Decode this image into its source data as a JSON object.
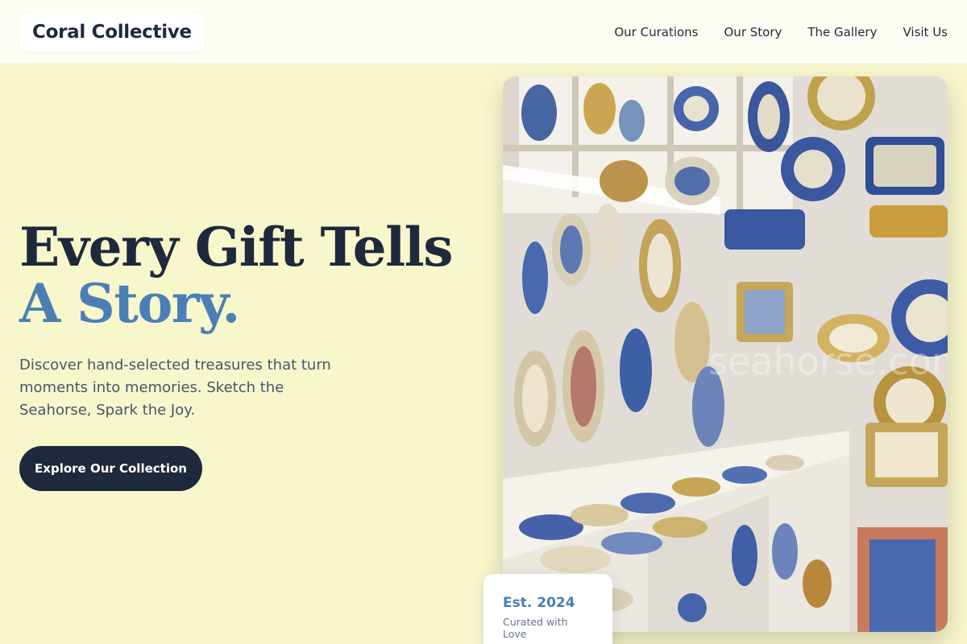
{
  "header": {
    "logo": "Coral Collective",
    "nav": [
      "Our Curations",
      "Our Story",
      "The Gallery",
      "Visit Us"
    ]
  },
  "hero": {
    "headline_line1": "Every Gift Tells",
    "headline_line2": "A Story.",
    "subtext": "Discover hand-selected treasures that turn moments into memories. Sketch the Seahorse, Spark the Joy.",
    "cta_label": "Explore Our Collection"
  },
  "badge": {
    "year": "Est. 2024",
    "caption": "Curated with Love"
  },
  "image": {
    "description_icon": "ceramic-shop-photo",
    "watermark": "seahorse.com"
  },
  "colors": {
    "background": "#f8f7cc",
    "navy": "#1e293b",
    "accent_blue": "#4a7fb5"
  }
}
